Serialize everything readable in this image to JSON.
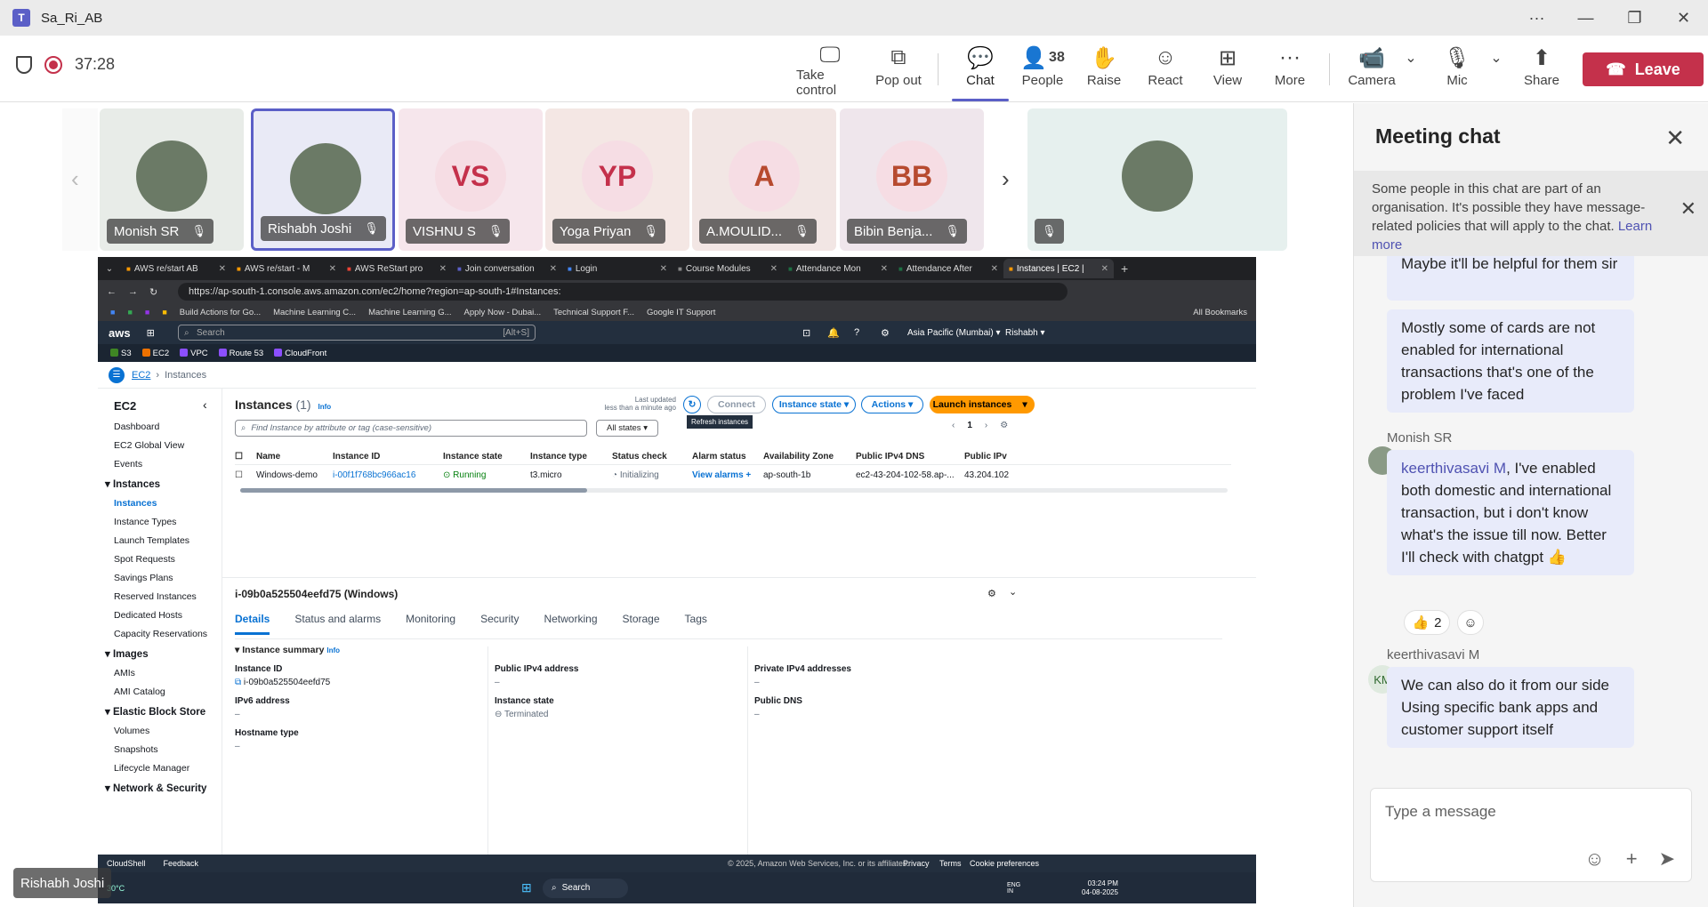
{
  "window": {
    "title": "Sa_Ri_AB",
    "logo": "T"
  },
  "meeting": {
    "elapsed": "37:28"
  },
  "toolbar": {
    "take_control": "Take control",
    "pop_out": "Pop out",
    "chat": "Chat",
    "people": "People",
    "people_count": "38",
    "raise": "Raise",
    "react": "React",
    "view": "View",
    "more": "More",
    "camera": "Camera",
    "mic": "Mic",
    "share": "Share",
    "leave": "Leave"
  },
  "participants": [
    {
      "name": "Monish SR",
      "initials": "",
      "bg": "#e8ece8"
    },
    {
      "name": "Rishabh Joshi",
      "initials": "",
      "bg": "#e9eaf6"
    },
    {
      "name": "VISHNU S",
      "initials": "VS",
      "bg": "#f6e6ec"
    },
    {
      "name": "Yoga Priyan",
      "initials": "YP",
      "bg": "#f4e7e4"
    },
    {
      "name": "A.MOULID...",
      "initials": "A",
      "bg": "#f2e6e4"
    },
    {
      "name": "Bibin Benja...",
      "initials": "BB",
      "bg": "#efe6ec"
    },
    {
      "name": "",
      "initials": "",
      "bg": "#e6f0ee"
    }
  ],
  "self_name": "Rishabh Joshi",
  "browser": {
    "tabs": [
      "AWS re/start AB",
      "AWS re/start - M",
      "AWS ReStart pro",
      "Join conversation",
      "Login",
      "Course Modules",
      "Attendance Mon",
      "Attendance After",
      "Instances | EC2 |"
    ],
    "url": "https://ap-south-1.console.aws.amazon.com/ec2/home?region=ap-south-1#Instances:",
    "bookmarks": [
      "Build Actions for Go...",
      "Machine Learning C...",
      "Machine Learning G...",
      "Apply Now - Dubai...",
      "Technical Support F...",
      "Google IT Support",
      "All Bookmarks"
    ]
  },
  "aws": {
    "logo": "aws",
    "search_placeholder": "Search",
    "search_shortcut": "[Alt+S]",
    "region": "Asia Pacific (Mumbai) ▾",
    "user": "Rishabh ▾",
    "services": [
      "S3",
      "EC2",
      "VPC",
      "Route 53",
      "CloudFront"
    ],
    "breadcrumb": [
      "EC2",
      "Instances"
    ],
    "sidebar": {
      "title": "EC2",
      "top": [
        "Dashboard",
        "EC2 Global View",
        "Events"
      ],
      "sections": [
        {
          "title": "Instances",
          "items": [
            "Instances",
            "Instance Types",
            "Launch Templates",
            "Spot Requests",
            "Savings Plans",
            "Reserved Instances",
            "Dedicated Hosts",
            "Capacity Reservations"
          ]
        },
        {
          "title": "Images",
          "items": [
            "AMIs",
            "AMI Catalog"
          ]
        },
        {
          "title": "Elastic Block Store",
          "items": [
            "Volumes",
            "Snapshots",
            "Lifecycle Manager"
          ]
        },
        {
          "title": "Network & Security",
          "items": []
        }
      ]
    },
    "instances": {
      "heading": "Instances",
      "count": "(1)",
      "info": "Info",
      "last_updated": "Last updated",
      "last_updated_value": "less than a minute ago",
      "refresh_tooltip": "Refresh instances",
      "connect": "Connect",
      "instance_state": "Instance state ▾",
      "actions": "Actions ▾",
      "launch": "Launch instances",
      "filter_placeholder": "Find Instance by attribute or tag (case-sensitive)",
      "all_states": "All states ▾",
      "page": "1",
      "columns": [
        "Name",
        "Instance ID",
        "Instance state",
        "Instance type",
        "Status check",
        "Alarm status",
        "Availability Zone",
        "Public IPv4 DNS",
        "Public IPv"
      ],
      "rows": [
        {
          "name": "Windows-demo",
          "id": "i-00f1f768bc966ac16",
          "state": "Running",
          "type": "t3.micro",
          "status": "Initializing",
          "alarm": "View alarms +",
          "az": "ap-south-1b",
          "dns": "ec2-43-204-102-58.ap-...",
          "ip": "43.204.102"
        }
      ]
    },
    "detail": {
      "title": "i-09b0a525504eefd75 (Windows)",
      "tabs": [
        "Details",
        "Status and alarms",
        "Monitoring",
        "Security",
        "Networking",
        "Storage",
        "Tags"
      ],
      "summary": "Instance summary",
      "info": "Info",
      "fields": {
        "instance_id_label": "Instance ID",
        "instance_id": "i-09b0a525504eefd75",
        "ipv6_label": "IPv6 address",
        "ipv6": "–",
        "hostname_label": "Hostname type",
        "hostname": "–",
        "public_ipv4_label": "Public IPv4 address",
        "public_ipv4": "–",
        "instance_state_label": "Instance state",
        "instance_state": "Terminated",
        "private_ipv4_label": "Private IPv4 addresses",
        "private_ipv4": "–",
        "public_dns_label": "Public DNS",
        "public_dns": "–"
      }
    },
    "footer": {
      "cloudshell": "CloudShell",
      "feedback": "Feedback",
      "copyright": "© 2025, Amazon Web Services, Inc. or its affiliates.",
      "privacy": "Privacy",
      "terms": "Terms",
      "cookies": "Cookie preferences"
    },
    "taskbar": {
      "search": "Search",
      "lang": "ENG IN",
      "time": "03:24 PM",
      "date": "04-08-2025",
      "temp": "30°C"
    }
  },
  "chat": {
    "title": "Meeting chat",
    "notice": "Some people in this chat are part of an organisation. It's possible they have message-related policies that will apply to the chat.",
    "learn_more": "Learn more",
    "messages": [
      {
        "text": "Maybe it'll be helpful for them sir"
      },
      {
        "text": "Mostly some of cards are not enabled for international transactions that's one of the problem I've faced"
      },
      {
        "sender": "Monish SR",
        "mention": "keerthivasavi M",
        "text": ", I've enabled both domestic and international transaction, but i don't know what's the issue till now. Better I'll check with chatgpt 👍",
        "reaction": "👍",
        "reaction_count": "2"
      },
      {
        "sender": "keerthivasavi M",
        "initials": "KM",
        "text": "We can also do it from our side Using specific bank apps and customer support itself"
      }
    ],
    "compose_placeholder": "Type a message"
  }
}
